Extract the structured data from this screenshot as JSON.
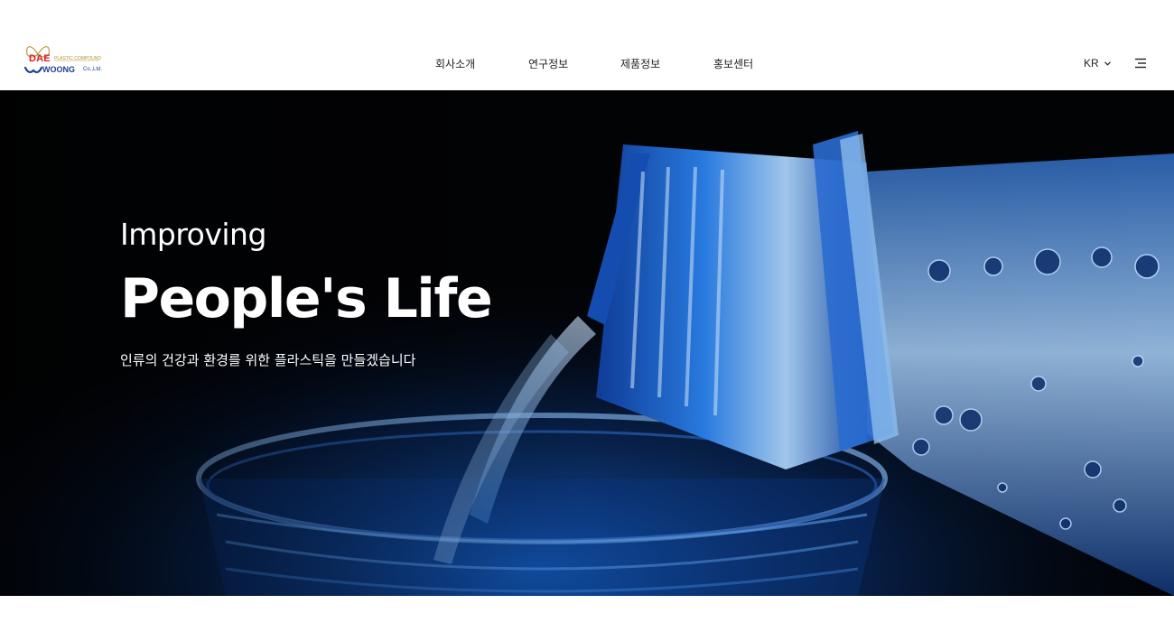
{
  "header": {
    "logo": {
      "dae": "DAE",
      "subtitle": "PLASTIC COMPOUND",
      "woong": "WOONG",
      "co": "Co.,Ltd."
    },
    "nav": [
      "회사소개",
      "연구정보",
      "제품정보",
      "홍보센터"
    ],
    "lang": "KR",
    "icons": {
      "lang_caret": "chevron-down-icon",
      "menu": "hamburger-menu-icon"
    }
  },
  "hero": {
    "kicker": "Improving",
    "title": "People's Life",
    "subtitle": "인류의 건강과 환경를 위한 플라스틱을 만들겠습니다",
    "image": "water-bottle-pouring-into-glass"
  },
  "colors": {
    "brand_red": "#d61f26",
    "brand_blue": "#1d3f8f",
    "brand_gold": "#b39231",
    "hero_accent": "#1e6fd9"
  }
}
